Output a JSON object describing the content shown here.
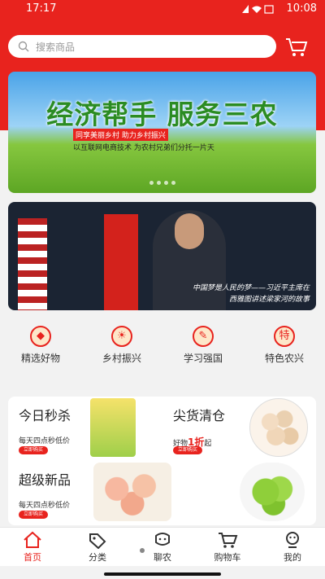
{
  "status_bar": {
    "time_left": "17:17",
    "time_right": "10:08"
  },
  "search": {
    "placeholder": "搜索商品"
  },
  "banner": {
    "title": "经济帮手 服务三农",
    "tag": "同享美丽乡村 助力乡村振兴",
    "subtitle": "以互联网电商技术   为农村兄弟们分托一片天"
  },
  "news_photo": {
    "caption_line1": "中国梦是人民的梦——习近平主席在",
    "caption_line2": "西雅图讲述梁家河的故事"
  },
  "categories": [
    {
      "label": "精选好物",
      "icon": "diamond-icon"
    },
    {
      "label": "乡村振兴",
      "icon": "sun-icon"
    },
    {
      "label": "学习强国",
      "icon": "pen-icon"
    },
    {
      "label": "特色农兴",
      "icon": "special-icon",
      "badge": "特"
    }
  ],
  "promos": {
    "flash_sale": {
      "title": "今日秒杀",
      "desc": "每天四点秒低价",
      "button": "立即购买"
    },
    "clearance": {
      "title": "尖货清仓",
      "desc_prefix": "好物",
      "discount": "1折",
      "desc_suffix": "起",
      "button": "立即购买"
    },
    "new_arrivals": {
      "title": "超级新品",
      "desc": "每天四点秒低价",
      "button": "立即购买"
    }
  },
  "bottom_nav": [
    {
      "label": "首页",
      "icon": "home-icon",
      "active": true
    },
    {
      "label": "分类",
      "icon": "tag-icon",
      "active": false
    },
    {
      "label": "聊农",
      "icon": "chat-icon",
      "active": false
    },
    {
      "label": "购物车",
      "icon": "cart-icon",
      "active": false
    },
    {
      "label": "我的",
      "icon": "profile-icon",
      "active": false
    }
  ],
  "colors": {
    "accent": "#e8231e",
    "banner_text": "#2b8c23"
  }
}
